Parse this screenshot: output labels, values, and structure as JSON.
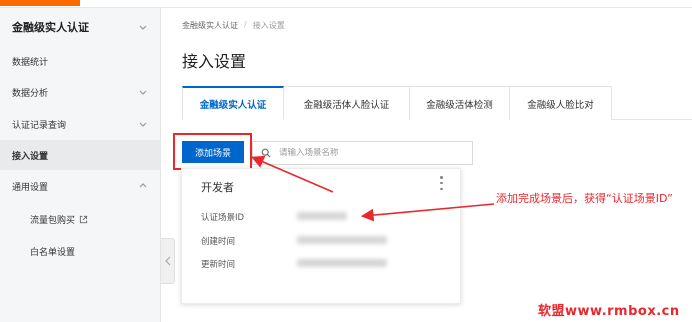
{
  "sidebar": {
    "title": "金融级实人认证",
    "items": [
      {
        "label": "数据统计",
        "chevron": ""
      },
      {
        "label": "数据分析",
        "chevron": "chevron-down"
      },
      {
        "label": "认证记录查询",
        "chevron": "chevron-down"
      },
      {
        "label": "接入设置",
        "chevron": "",
        "active": true
      },
      {
        "label": "通用设置",
        "chevron": "chevron-up"
      },
      {
        "label": "流量包购买",
        "sub": true,
        "icon": "external-link-icon"
      },
      {
        "label": "白名单设置",
        "sub": true
      }
    ]
  },
  "breadcrumb": {
    "root": "金融级实人认证",
    "separator": "/",
    "current": "接入设置"
  },
  "page": {
    "title": "接入设置"
  },
  "tabs": [
    {
      "label": "金融级实人认证",
      "active": true
    },
    {
      "label": "金融级活体人脸认证",
      "active": false
    },
    {
      "label": "金融级活体检测",
      "active": false
    },
    {
      "label": "金融级人脸比对",
      "active": false
    }
  ],
  "toolbar": {
    "add_label": "添加场景",
    "search_placeholder": "请输入场景名称"
  },
  "card": {
    "title": "开发者",
    "fields": [
      {
        "label": "认证场景ID"
      },
      {
        "label": "创建时间"
      },
      {
        "label": "更新时间"
      }
    ]
  },
  "annotation": {
    "text": "添加完成场景后，获得“认证场景ID”",
    "color": "#e8282d"
  },
  "watermark": "软盟www.rmbox.cn",
  "colors": {
    "accent": "#0066cc",
    "annotation": "#e8282d",
    "brand_top": "#ff6a00"
  }
}
